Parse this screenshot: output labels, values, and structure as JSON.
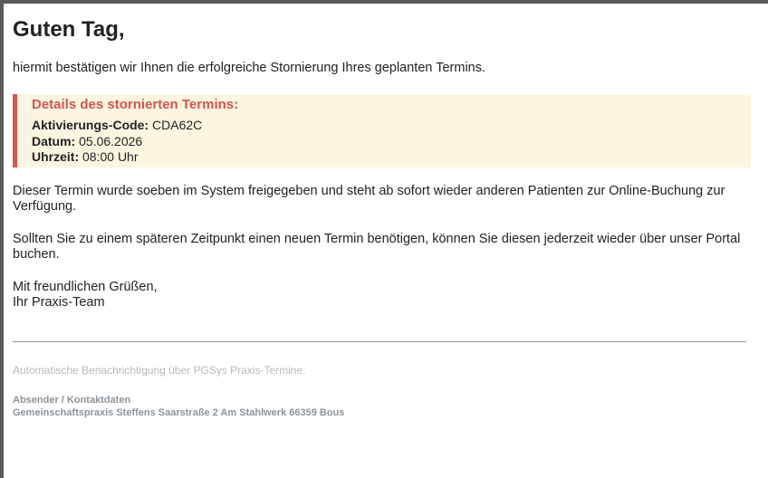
{
  "email": {
    "greeting": "Guten Tag,",
    "intro": "hiermit bestätigen wir Ihnen die erfolgreiche Stornierung Ihres geplanten Termins.",
    "details": {
      "title": "Details des stornierten Termins:",
      "code_label": "Aktivierungs-Code:",
      "code_value": "CDA62C",
      "date_label": "Datum:",
      "date_value": "05.06.2026",
      "time_label": "Uhrzeit:",
      "time_value": "08:00 Uhr"
    },
    "paragraph1": "Dieser Termin wurde soeben im System freigegeben und steht ab sofort wieder anderen Patienten zur Online-Buchung zur Verfügung.",
    "paragraph2": "Sollten Sie zu einem späteren Zeitpunkt einen neuen Termin benötigen, können Sie diesen jederzeit wieder über unser Portal buchen.",
    "closing_line1": "Mit freundlichen Grüßen,",
    "closing_line2": "Ihr Praxis-Team",
    "footer": {
      "note": "Automatische Benachrichtigung über PGSys Praxis-Termine.",
      "sender_label": "Absender / Kontaktdaten",
      "sender_value": "Gemeinschaftspraxis Steffens Saarstraße 2 Am Stahlwerk 66359 Bous"
    }
  },
  "colors": {
    "accent": "#d9534f",
    "details_background": "#fcf6e0",
    "footer_text": "#8a949c",
    "frame": "#5b5b5b"
  }
}
